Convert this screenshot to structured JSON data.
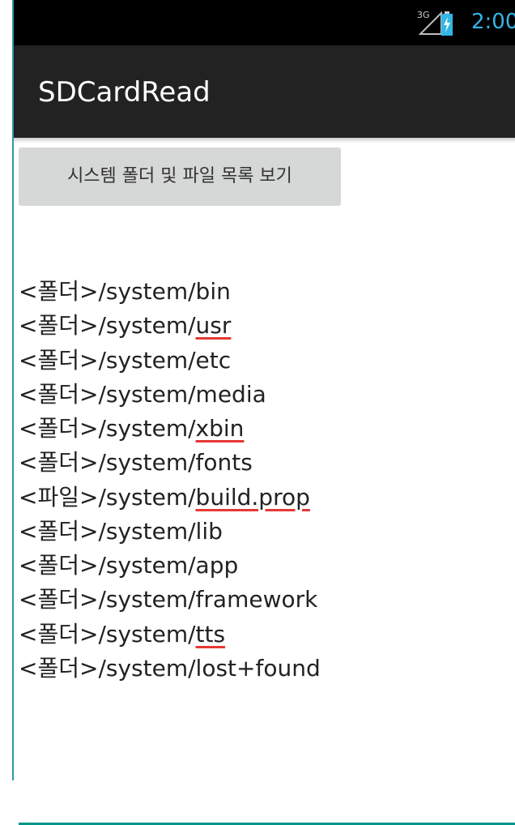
{
  "status_bar": {
    "network_label": "3G",
    "time": "2:00",
    "accent_color": "#33b5e5"
  },
  "action_bar": {
    "title": "SDCardRead"
  },
  "main": {
    "button_label": "시스템 폴더 및 파일 목록 보기",
    "entries": [
      {
        "prefix": "<폴더>/system/",
        "name": "bin",
        "flagged": false
      },
      {
        "prefix": "<폴더>/system/",
        "name": "usr",
        "flagged": true
      },
      {
        "prefix": "<폴더>/system/",
        "name": "etc",
        "flagged": false
      },
      {
        "prefix": "<폴더>/system/",
        "name": "media",
        "flagged": false
      },
      {
        "prefix": "<폴더>/system/",
        "name": "xbin",
        "flagged": true
      },
      {
        "prefix": "<폴더>/system/",
        "name": "fonts",
        "flagged": false
      },
      {
        "prefix": "<파일>/system/",
        "name": "build.prop",
        "flagged": true
      },
      {
        "prefix": "<폴더>/system/",
        "name": "lib",
        "flagged": false
      },
      {
        "prefix": "<폴더>/system/",
        "name": "app",
        "flagged": false
      },
      {
        "prefix": "<폴더>/system/",
        "name": "framework",
        "flagged": false
      },
      {
        "prefix": "<폴더>/system/",
        "name": "tts",
        "flagged": true
      },
      {
        "prefix": "<폴더>/system/",
        "name": "lost+found",
        "flagged": false
      }
    ],
    "underline_color": "#009688",
    "spellcheck_color": "#e53935"
  }
}
